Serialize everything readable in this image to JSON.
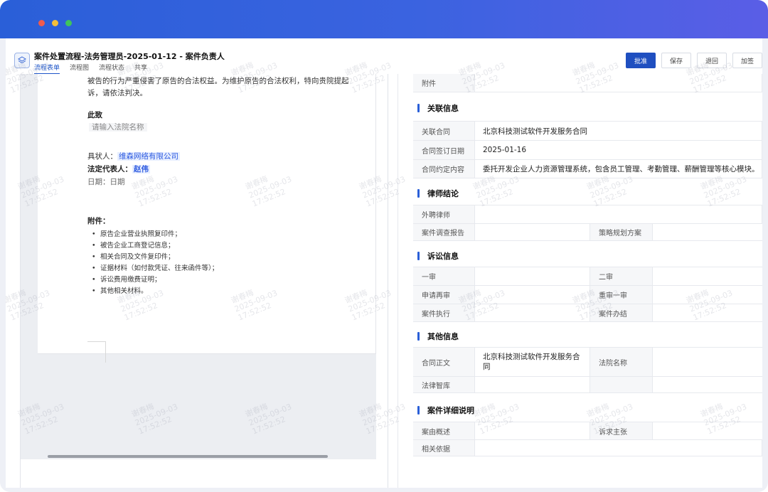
{
  "app": {
    "title": "案件处置流程-法务管理员-2025-01-12 - 案件负责人",
    "tabs": [
      "流程表单",
      "流程图",
      "流程状态",
      "共享"
    ],
    "actions": {
      "approve": "批准",
      "save": "保存",
      "return": "退回",
      "countersign": "加签"
    }
  },
  "document": {
    "line1": "被告的行为严重侵害了原告的合法权益。为维护原告的合法权利，特向贵院提起",
    "line2": "诉，请依法判决。",
    "closing": "此致",
    "court_placeholder": "请输入法院名称",
    "plaintiff_label": "具状人：",
    "plaintiff_value": "维森网络有限公司",
    "legal_rep_label": "法定代表人：",
    "legal_rep_value": "赵伟",
    "date_label": "日期：",
    "date_value": "日期",
    "attachments_title": "附件：",
    "attachments": [
      "原告企业营业执照复印件；",
      "被告企业工商登记信息；",
      "相关合同及文件复印件；",
      "证据材料（如付款凭证、往来函件等）；",
      "诉讼费用缴费证明；",
      "其他相关材料。"
    ]
  },
  "form": {
    "attachment_label": "附件",
    "related": {
      "title": "关联信息",
      "contract_label": "关联合同",
      "contract_value": "北京科技测试软件开发服务合同",
      "sign_date_label": "合同签订日期",
      "sign_date_value": "2025-01-16",
      "content_label": "合同约定内容",
      "content_value": "委托开发企业人力资源管理系统，包含员工管理、考勤管理、薪酬管理等核心模块。"
    },
    "lawyer": {
      "title": "律师结论",
      "external_label": "外聘律师",
      "report_label": "案件调查报告",
      "strategy_label": "策略规划方案"
    },
    "litigation": {
      "title": "诉讼信息",
      "first_label": "一审",
      "second_label": "二审",
      "retrial_label": "申请再审",
      "retrial_first_label": "重审一审",
      "execution_label": "案件执行",
      "closure_label": "案件办结"
    },
    "other": {
      "title": "其他信息",
      "contract_text_label": "合同正文",
      "contract_text_value": "北京科技测试软件开发服务合同",
      "court_name_label": "法院名称",
      "legal_db_label": "法律智库"
    },
    "details": {
      "title": "案件详细说明",
      "summary_label": "案由概述",
      "claim_label": "诉求主张",
      "basis_label": "相关依据"
    }
  },
  "watermark": {
    "name": "谢春梅",
    "date": "2025-09-03",
    "time": "17:52:52"
  },
  "colors": {
    "accent": "#1f4fc0",
    "titlebar_start": "#2a5fd8",
    "titlebar_end": "#5a5ee6"
  },
  "icons": {
    "app": "layers-icon"
  }
}
